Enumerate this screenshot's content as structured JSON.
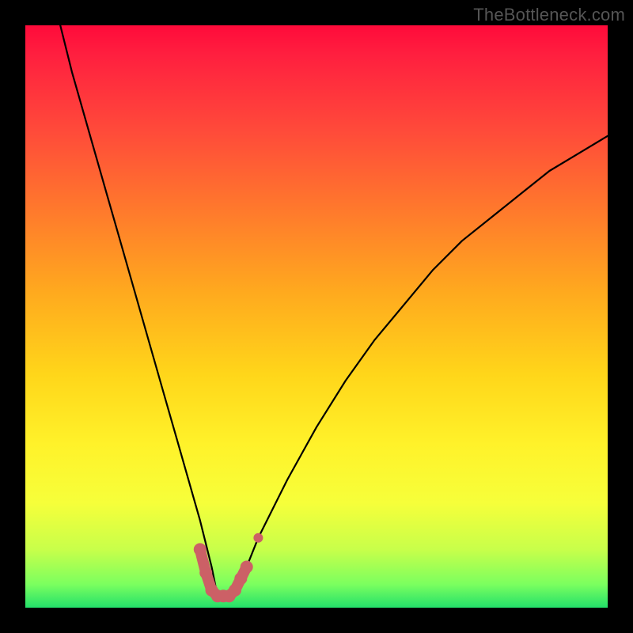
{
  "attribution": "TheBottleneck.com",
  "chart_data": {
    "type": "line",
    "title": "",
    "xlabel": "",
    "ylabel": "",
    "x_range": [
      0,
      100
    ],
    "y_range": [
      0,
      100
    ],
    "grid": false,
    "legend": false,
    "series": [
      {
        "name": "bottleneck-curve",
        "color": "#000000",
        "x": [
          6,
          8,
          10,
          12,
          14,
          16,
          18,
          20,
          22,
          24,
          26,
          28,
          30,
          32,
          33,
          34,
          36,
          38,
          40,
          45,
          50,
          55,
          60,
          65,
          70,
          75,
          80,
          85,
          90,
          95,
          100
        ],
        "values": [
          100,
          92,
          85,
          78,
          71,
          64,
          57,
          50,
          43,
          36,
          29,
          22,
          15,
          7,
          2,
          2,
          2,
          7,
          12,
          22,
          31,
          39,
          46,
          52,
          58,
          63,
          67,
          71,
          75,
          78,
          81
        ]
      }
    ],
    "highlight": {
      "name": "optimal-region",
      "color": "#cc6066",
      "points": [
        {
          "x": 30,
          "y": 10
        },
        {
          "x": 31,
          "y": 6
        },
        {
          "x": 32,
          "y": 3
        },
        {
          "x": 33,
          "y": 2
        },
        {
          "x": 34,
          "y": 2
        },
        {
          "x": 35,
          "y": 2
        },
        {
          "x": 36,
          "y": 3
        },
        {
          "x": 37,
          "y": 5
        },
        {
          "x": 38,
          "y": 7
        },
        {
          "x": 40,
          "y": 12
        }
      ]
    },
    "background_gradient": {
      "top": "#ff0a3a",
      "bottom": "#23e06a"
    }
  }
}
